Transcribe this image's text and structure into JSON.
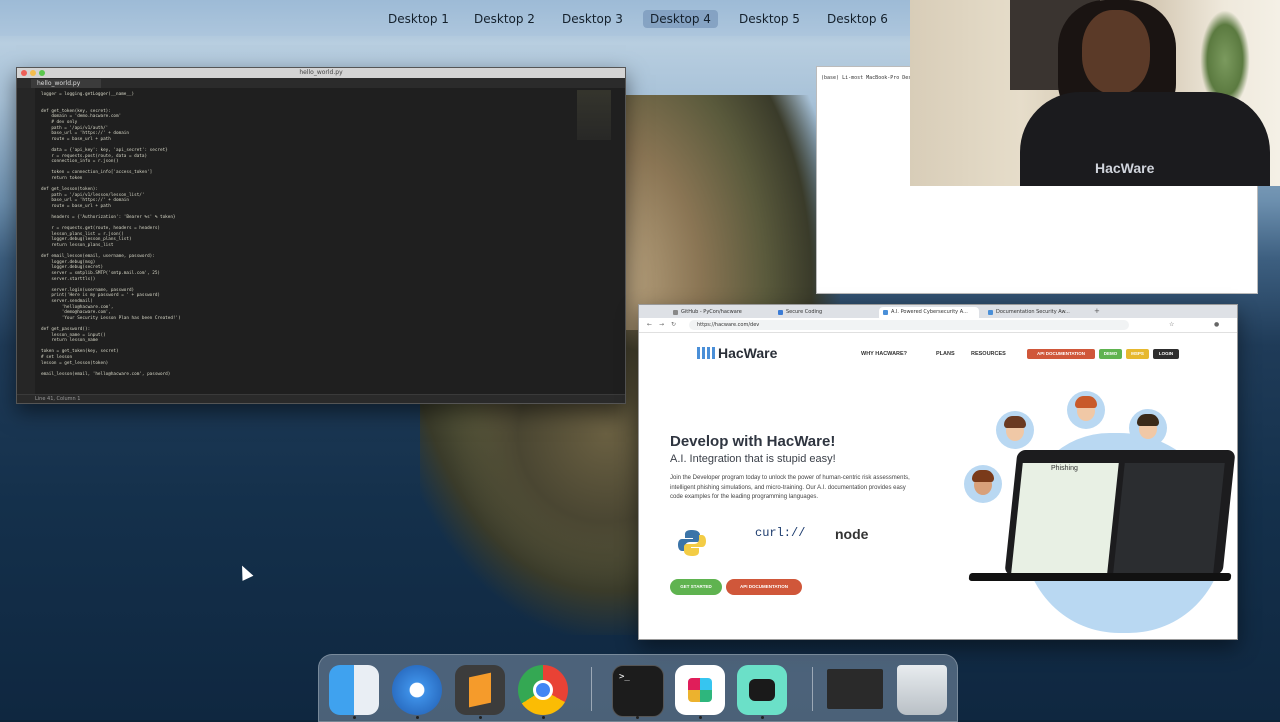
{
  "mission_control": {
    "desktops": [
      "Desktop 1",
      "Desktop 2",
      "Desktop 3",
      "Desktop 4",
      "Desktop 5",
      "Desktop 6"
    ],
    "active_index": 3
  },
  "sublime": {
    "title": "hello_world.py",
    "tab": "hello_world.py",
    "status_left": "Line 41, Column 1",
    "code_lines": [
      "logger = logging.getLogger(__name__)",
      "",
      "",
      "def get_token(key, secret):",
      "    domain = 'demo.hacware.com'",
      "    # dev only",
      "    path = '/api/v1/auth/'",
      "    base_url = 'https://' + domain",
      "    route = base_url + path",
      "",
      "    data = {'api_key': key, 'api_secret': secret}",
      "    r = requests.post(route, data = data)",
      "    connection_info = r.json()",
      "",
      "    token = connection_info['access_token']",
      "    return token",
      "",
      "def get_lesson(token):",
      "    path = '/api/v1/lesson/lesson_list/'",
      "    base_url = 'https://' + domain",
      "    route = base_url + path",
      "",
      "    headers = {'Authorization': 'Bearer %s' % token}",
      "",
      "    r = requests.get(route, headers = headers)",
      "    lesson_plans_list = r.json()",
      "    logger.debug(lesson_plans_list)",
      "    return lesson_plans_list",
      "",
      "def email_lesson(email, username, password):",
      "    logger.debug(msg)",
      "    logger.debug(secret)",
      "    server = smtplib.SMTP('smtp.mail.com', 25)",
      "    server.starttls()",
      "",
      "    server.login(username, password)",
      "    print('Here is my password = ' + password)",
      "    server.sendmail(",
      "        'hello@hacware.com',",
      "        'demo@hacware.com',",
      "        'Your Security Lesson Plan has been Created!')",
      "",
      "def get_password():",
      "    lesson_name = input()",
      "    return lesson_name",
      "",
      "token = get_token(key, secret)",
      "# set lesson",
      "lesson = get_lesson(token)",
      "",
      "email_lesson(email, 'hello@hacware.com', password)"
    ]
  },
  "terminal": {
    "prompt": "(base) Li-most MacBook-Pro Desktop %"
  },
  "webcam": {
    "shirt_text": "HacWare"
  },
  "chrome": {
    "tabs": [
      {
        "label": "GitHub - PyCon/hacware"
      },
      {
        "label": "Secure Coding"
      },
      {
        "label": "A.I. Powered Cybersecurity A..."
      },
      {
        "label": "Documentation Security Aw..."
      }
    ],
    "active_tab": 2,
    "url": "https://hacware.com/dev"
  },
  "hacware": {
    "logo": "HacWare",
    "nav": [
      "WHY HACWARE?",
      "PLANS",
      "RESOURCES"
    ],
    "pills": [
      {
        "label": "API DOCUMENTATION",
        "color": "#d0573a"
      },
      {
        "label": "DEMO",
        "color": "#5fb350"
      },
      {
        "label": "MSPS",
        "color": "#e6b82e"
      },
      {
        "label": "LOGIN",
        "color": "#2d2d2d"
      }
    ],
    "hero_title": "Develop with HacWare!",
    "hero_subtitle": "A.I. Integration that is stupid easy!",
    "hero_body": "Join the Developer program today to unlock the power of human-centric risk assessments, intelligent phishing simulations, and micro-training. Our A.I. documentation provides easy code examples for the leading programming languages.",
    "curl_label": "curl://",
    "node_label": "node",
    "btn_get_started": "GET STARTED",
    "btn_api_docs": "API DOCUMENTATION",
    "laptop_label": "Phishing"
  },
  "dock": {
    "apps": [
      "Finder",
      "Safari",
      "Sublime Text",
      "Chrome",
      "Terminal",
      "Slack",
      "Loom",
      "Preview",
      "Trash"
    ]
  }
}
